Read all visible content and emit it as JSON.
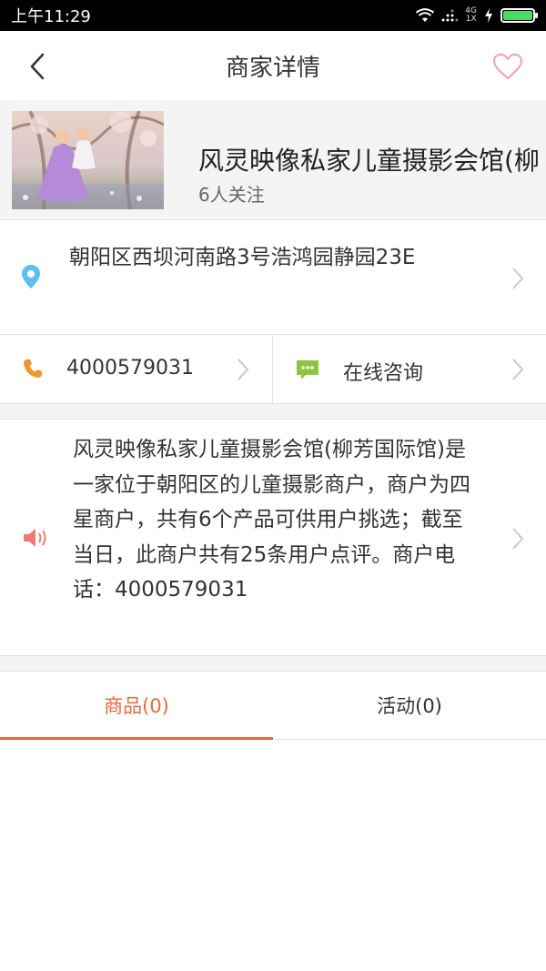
{
  "status_bar": {
    "time": "上午11:29",
    "network_top": "4G",
    "network_bottom": "1X",
    "battery_color": "#4cd964"
  },
  "header": {
    "title": "商家详情",
    "back_icon": "chevron-left-icon",
    "favorite_icon": "heart-outline-icon",
    "favorite_color": "#f0a0a8"
  },
  "shop": {
    "name": "风灵映像私家儿童摄影会馆(柳",
    "followers": "6人关注",
    "photo": "two-children-in-blossom-garden-photo"
  },
  "address": {
    "icon": "location-pin-icon",
    "icon_color": "#5bc0f0",
    "text": "朝阳区西坝河南路3号浩鸿园静园23E"
  },
  "contact": {
    "phone_icon": "phone-icon",
    "phone_icon_color": "#f0962e",
    "phone": "4000579031",
    "consult_icon": "chat-bubble-icon",
    "consult_icon_color": "#8cc63f",
    "consult_label": "在线咨询"
  },
  "description": {
    "icon": "speaker-icon",
    "icon_color": "#f07a7a",
    "text": "风灵映像私家儿童摄影会馆(柳芳国际馆)是一家位于朝阳区的儿童摄影商户，商户为四星商户，共有6个产品可供用户挑选；截至当日，此商户共有25条用户点评。商户电话：4000579031"
  },
  "tabs": [
    {
      "label": "商品(0)",
      "active": true
    },
    {
      "label": "活动(0)",
      "active": false
    }
  ],
  "accent_color": "#e8683a"
}
